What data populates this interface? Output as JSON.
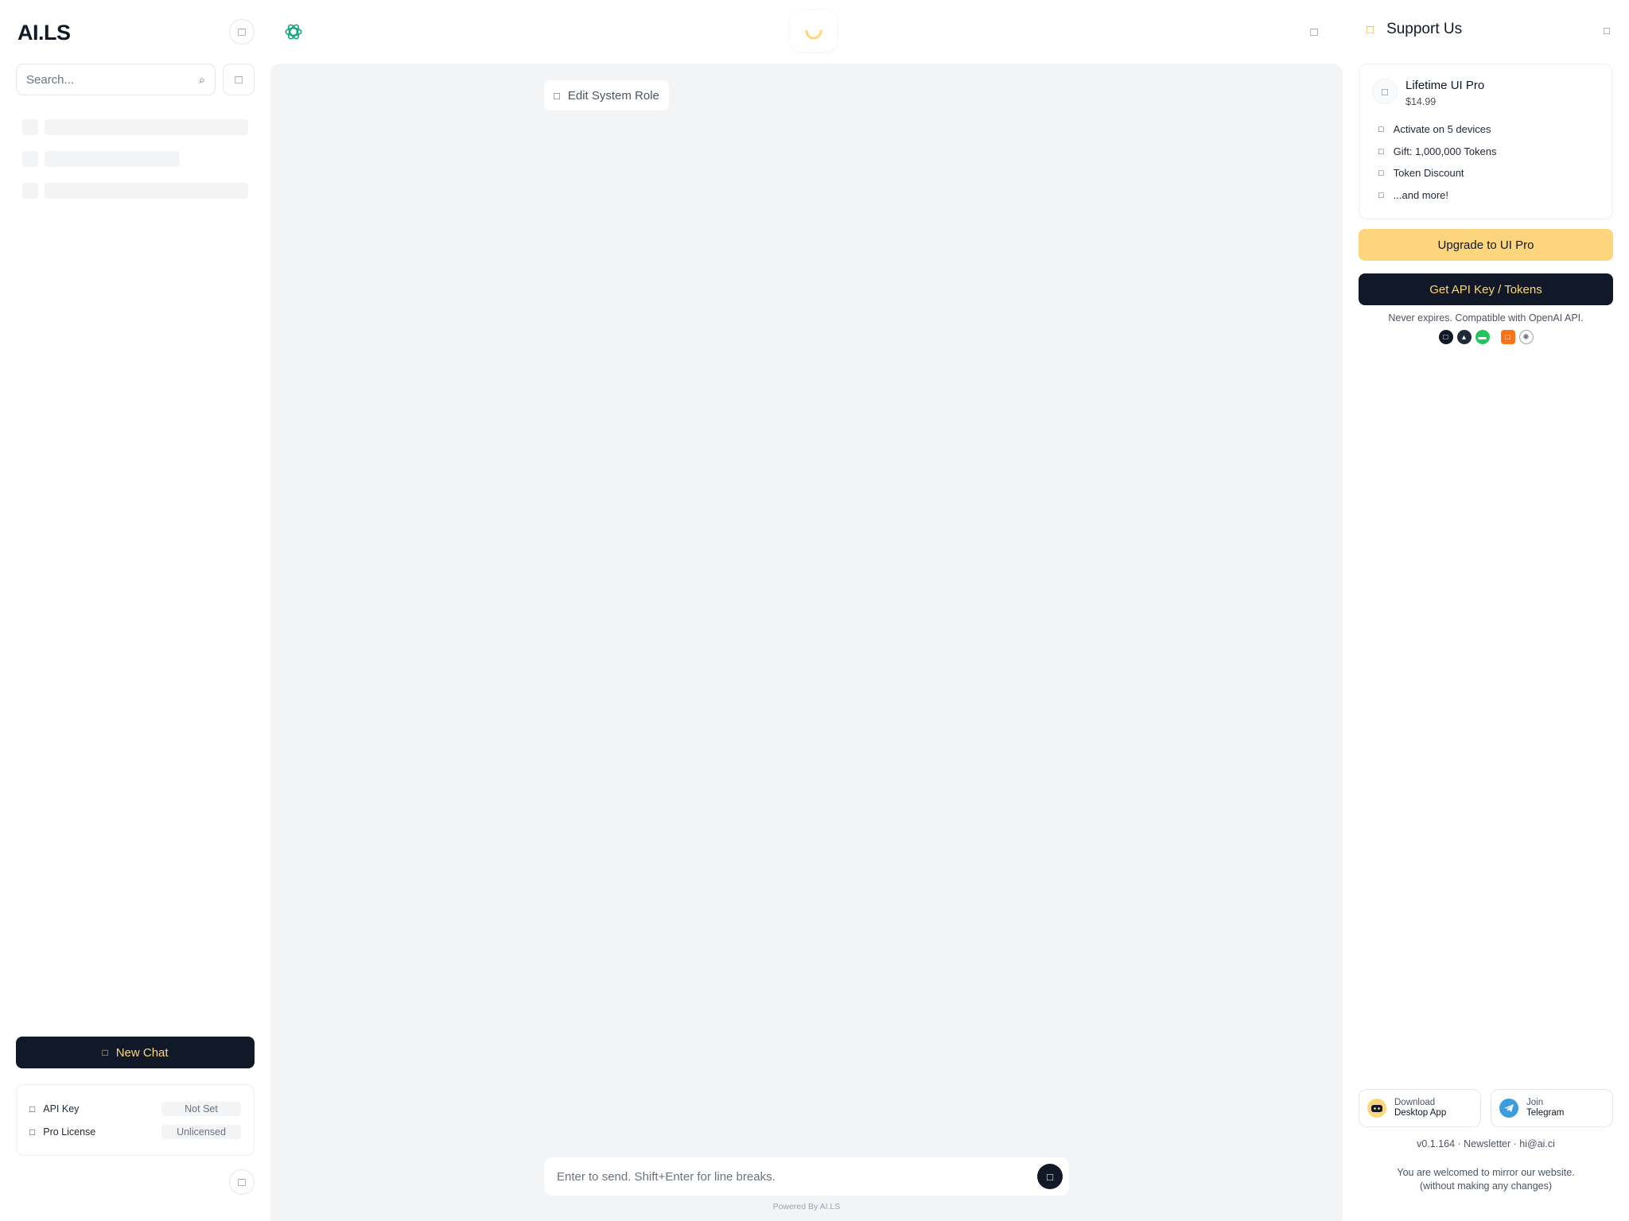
{
  "app": {
    "logo_text": "AI.LS"
  },
  "sidebar": {
    "search": {
      "placeholder": "Search...",
      "value": ""
    },
    "new_chat_label": "New Chat",
    "status": [
      {
        "label": "API Key",
        "value": "Not Set",
        "icon": "key-icon"
      },
      {
        "label": "Pro License",
        "value": "Unlicensed",
        "icon": "license-icon"
      }
    ]
  },
  "chat": {
    "edit_system_role_label": "Edit System Role",
    "composer_placeholder": "Enter to send. Shift+Enter for line breaks.",
    "powered_by": "Powered By AI.LS"
  },
  "support": {
    "title": "Support Us",
    "plan": {
      "name": "Lifetime UI Pro",
      "price": "$14.99",
      "features": [
        "Activate on 5 devices",
        "Gift: 1,000,000 Tokens",
        "Token Discount",
        "...and more!"
      ]
    },
    "upgrade_label": "Upgrade to UI Pro",
    "api_key_label": "Get API Key / Tokens",
    "never_expires": "Never expires. Compatible with OpenAI API.",
    "desktop_app": {
      "line1": "Download",
      "line2": "Desktop App"
    },
    "telegram": {
      "line1": "Join",
      "line2": "Telegram"
    },
    "version_line": "v0.1.164 · Newsletter · hi@ai.ci",
    "mirror_note_1": "You are welcomed to mirror our website.",
    "mirror_note_2": "(without making any changes)"
  },
  "colors": {
    "accent_yellow": "#fcd57c",
    "dark": "#111827",
    "chat_bg": "#f3f4f6",
    "openai_green": "#10a37f"
  }
}
